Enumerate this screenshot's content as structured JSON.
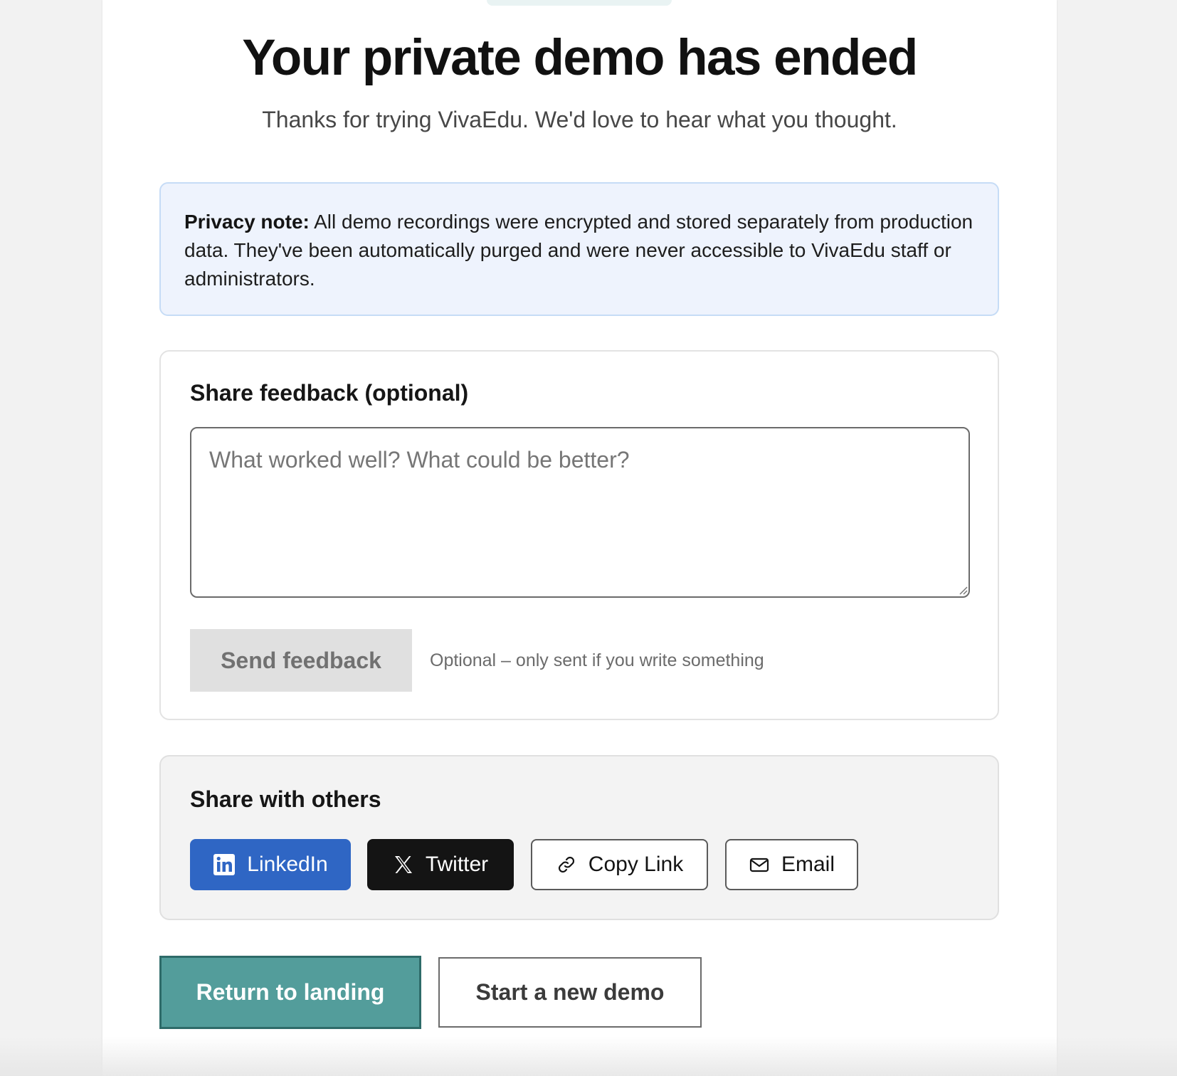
{
  "header": {
    "title": "Your private demo has ended",
    "subtitle": "Thanks for trying VivaEdu. We'd love to hear what you thought."
  },
  "privacy": {
    "label": "Privacy note:",
    "text": " All demo recordings were encrypted and stored separately from production data. They've been automatically purged and were never accessible to VivaEdu staff or administrators."
  },
  "feedback": {
    "title": "Share feedback (optional)",
    "placeholder": "What worked well? What could be better?",
    "value": "",
    "send_label": "Send feedback",
    "hint": "Optional – only sent if you write something"
  },
  "share": {
    "title": "Share with others",
    "linkedin_label": "LinkedIn",
    "twitter_label": "Twitter",
    "copy_label": "Copy Link",
    "email_label": "Email",
    "icons": [
      "linkedin-icon",
      "x-icon",
      "link-icon",
      "mail-icon"
    ]
  },
  "actions": {
    "return_label": "Return to landing",
    "new_demo_label": "Start a new demo"
  },
  "colors": {
    "accent": "#539d9b",
    "linkedin": "#2f66c4",
    "twitter": "#141414",
    "privacy_bg": "#eef3fd"
  }
}
